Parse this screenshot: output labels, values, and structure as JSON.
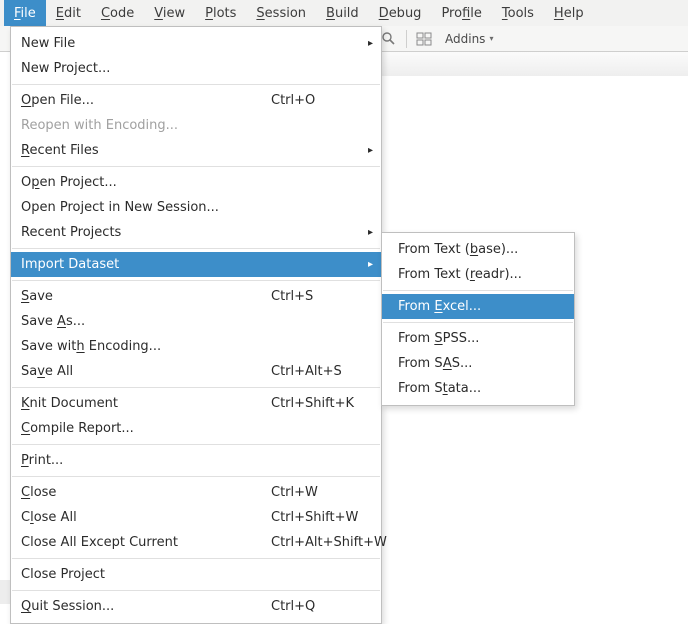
{
  "menubar": {
    "file": {
      "pre": "",
      "u": "F",
      "post": "ile"
    },
    "edit": {
      "pre": "",
      "u": "E",
      "post": "dit"
    },
    "code": {
      "pre": "",
      "u": "C",
      "post": "ode"
    },
    "view": {
      "pre": "",
      "u": "V",
      "post": "iew"
    },
    "plots": {
      "pre": "",
      "u": "P",
      "post": "lots"
    },
    "session": {
      "pre": "",
      "u": "S",
      "post": "ession"
    },
    "build": {
      "pre": "",
      "u": "B",
      "post": "uild"
    },
    "debug": {
      "pre": "",
      "u": "D",
      "post": "ebug"
    },
    "profile": {
      "pre": "Pro",
      "u": "f",
      "post": "ile"
    },
    "tools": {
      "pre": "",
      "u": "T",
      "post": "ools"
    },
    "help": {
      "pre": "",
      "u": "H",
      "post": "elp"
    }
  },
  "toolbar": {
    "addins_label": "Addins"
  },
  "file_menu": {
    "new_file": {
      "label_pre": "New File",
      "label_u": "",
      "label_post": "",
      "short": "",
      "has_sub": true
    },
    "new_project": {
      "label_pre": "New Project...",
      "label_u": "",
      "label_post": "",
      "short": ""
    },
    "open_file": {
      "label_pre": "",
      "label_u": "O",
      "label_post": "pen File...",
      "short": "Ctrl+O"
    },
    "reopen_enc": {
      "label_pre": "Reopen with Encoding...",
      "label_u": "",
      "label_post": "",
      "short": "",
      "disabled": true
    },
    "recent_files": {
      "label_pre": "",
      "label_u": "R",
      "label_post": "ecent Files",
      "short": "",
      "has_sub": true
    },
    "open_project": {
      "label_pre": "O",
      "label_u": "p",
      "label_post": "en Project...",
      "short": ""
    },
    "open_proj_new": {
      "label_pre": "Open Project in New Session...",
      "label_u": "",
      "label_post": "",
      "short": ""
    },
    "recent_projects": {
      "label_pre": "Recent Projects",
      "label_u": "",
      "label_post": "",
      "short": "",
      "has_sub": true
    },
    "import_dataset": {
      "label_pre": "Import Dataset",
      "label_u": "",
      "label_post": "",
      "short": "",
      "has_sub": true,
      "highlight": true
    },
    "save": {
      "label_pre": "",
      "label_u": "S",
      "label_post": "ave",
      "short": "Ctrl+S"
    },
    "save_as": {
      "label_pre": "Save ",
      "label_u": "A",
      "label_post": "s...",
      "short": ""
    },
    "save_enc": {
      "label_pre": "Save wit",
      "label_u": "h",
      "label_post": " Encoding...",
      "short": ""
    },
    "save_all": {
      "label_pre": "Sa",
      "label_u": "v",
      "label_post": "e All",
      "short": "Ctrl+Alt+S"
    },
    "knit": {
      "label_pre": "",
      "label_u": "K",
      "label_post": "nit Document",
      "short": "Ctrl+Shift+K"
    },
    "compile": {
      "label_pre": "",
      "label_u": "C",
      "label_post": "ompile Report...",
      "short": ""
    },
    "print": {
      "label_pre": "",
      "label_u": "P",
      "label_post": "rint...",
      "short": ""
    },
    "close": {
      "label_pre": "",
      "label_u": "C",
      "label_post": "lose",
      "short": "Ctrl+W"
    },
    "close_all": {
      "label_pre": "C",
      "label_u": "l",
      "label_post": "ose All",
      "short": "Ctrl+Shift+W"
    },
    "close_all_ex": {
      "label_pre": "Close All Except Current",
      "label_u": "",
      "label_post": "",
      "short": "Ctrl+Alt+Shift+W"
    },
    "close_project": {
      "label_pre": "Close Project",
      "label_u": "",
      "label_post": "",
      "short": ""
    },
    "quit": {
      "label_pre": "",
      "label_u": "Q",
      "label_post": "uit Session...",
      "short": "Ctrl+Q"
    }
  },
  "import_submenu": {
    "text_base": {
      "label_pre": "From Text (",
      "label_u": "b",
      "label_post": "ase)..."
    },
    "text_readr": {
      "label_pre": "From Text (",
      "label_u": "r",
      "label_post": "eadr)..."
    },
    "excel": {
      "label_pre": "From ",
      "label_u": "E",
      "label_post": "xcel...",
      "highlight": true
    },
    "spss": {
      "label_pre": "From ",
      "label_u": "S",
      "label_post": "PSS..."
    },
    "sas": {
      "label_pre": "From S",
      "label_u": "A",
      "label_post": "S..."
    },
    "stata": {
      "label_pre": "From S",
      "label_u": "t",
      "label_post": "ata..."
    }
  }
}
